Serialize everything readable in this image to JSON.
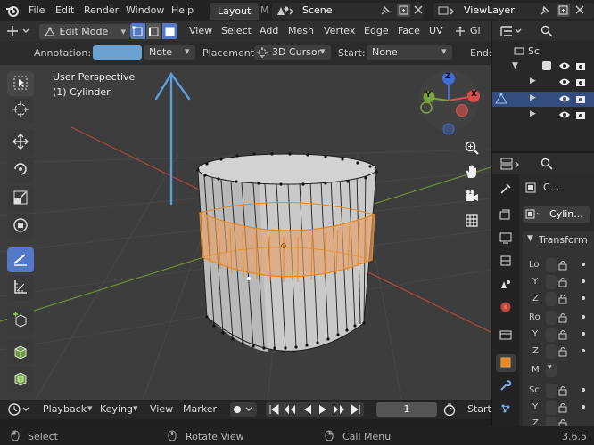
{
  "menu": {
    "file": "File",
    "edit": "Edit",
    "render": "Render",
    "window": "Window",
    "help": "Help"
  },
  "workspace": {
    "active_tab": "Layout",
    "next_tab": "M"
  },
  "scene": {
    "name": "Scene"
  },
  "view_layer": {
    "name": "ViewLayer"
  },
  "viewport_header": {
    "mode": "Edit Mode",
    "view": "View",
    "select": "Select",
    "add": "Add",
    "mesh": "Mesh",
    "vertex": "Vertex",
    "edge": "Edge",
    "face": "Face",
    "uv": "UV",
    "gl": "Gl"
  },
  "annotation_bar": {
    "annotation_label": "Annotation:",
    "annotation_color": "#6aa2d4",
    "note_value": "Note",
    "placement_label": "Placement:",
    "placement_value": "3D Cursor",
    "start_label": "Start:",
    "start_value": "None",
    "end_label": "End:"
  },
  "viewport": {
    "perspective": "User Perspective",
    "object": "(1) Cylinder"
  },
  "gizmo": {
    "z": "Z",
    "y": "Y",
    "x": "X"
  },
  "timeline": {
    "playback": "Playback",
    "keying": "Keying",
    "view": "View",
    "marker": "Marker",
    "frame": "1",
    "start": "Start"
  },
  "status": {
    "select": "Select",
    "rotate": "Rotate View",
    "call_menu": "Call Menu",
    "version": "3.6.5"
  },
  "outliner": {
    "scene_label": "Sc"
  },
  "properties": {
    "object_short": "C...",
    "object_name": "Cylin...",
    "panel_title": "Transform",
    "rows": [
      {
        "label": "Lo"
      },
      {
        "label": "Y"
      },
      {
        "label": "Z"
      },
      {
        "label": "Ro"
      },
      {
        "label": "Y"
      },
      {
        "label": "Z"
      },
      {
        "label": "M"
      },
      {
        "label": "Sc"
      },
      {
        "label": "Y"
      },
      {
        "label": "Z"
      }
    ]
  },
  "colors": {
    "accent": "#5478c8",
    "selection_orange": "#e8871e",
    "annotation_stroke": "#5a9ee0",
    "axis_red": "#d8504c",
    "axis_green": "#7aa33a",
    "axis_blue": "#3f6fd6"
  }
}
